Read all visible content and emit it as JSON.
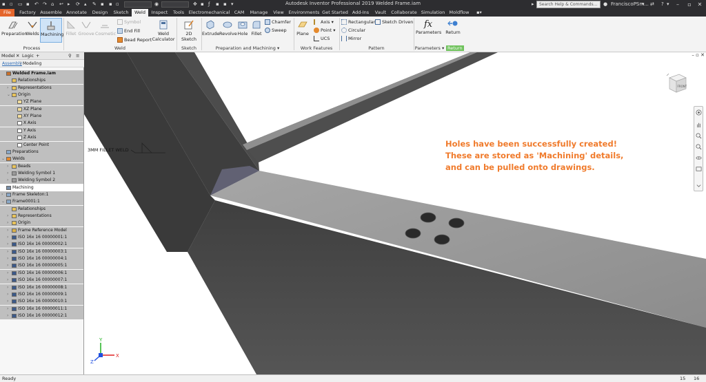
{
  "app": {
    "title": "Autodesk Inventor Professional 2019   Welded Frame.iam",
    "search_placeholder": "Search Help & Commands...",
    "user": "FranciscoPSm...",
    "help": "?"
  },
  "tabs": [
    "File",
    "Factory",
    "Assemble",
    "Annotate",
    "Design",
    "Sketch",
    "Weld",
    "Inspect",
    "Tools",
    "Electromechanical",
    "CAM",
    "Manage",
    "View",
    "Environments",
    "Get Started",
    "Add-Ins",
    "Vault",
    "Collaborate",
    "Simulation",
    "Moldflow"
  ],
  "ribbon": {
    "process": {
      "label": "Process",
      "preparation": "Preparation",
      "welds": "Welds",
      "machining": "Machining"
    },
    "weld": {
      "label": "Weld",
      "fillet": "Fillet",
      "groove": "Groove",
      "cosmetic": "Cosmetic",
      "symbol": "Symbol",
      "end_fill": "End Fill",
      "bead_report": "Bead Report",
      "weld_calculator": "Weld Calculator"
    },
    "sketch": {
      "label": "Sketch",
      "sketch_2d": "2D Sketch"
    },
    "prep": {
      "label": "Preparation and Machining",
      "extrude": "Extrude",
      "revolve": "Revolve",
      "hole": "Hole",
      "fillet": "Fillet",
      "chamfer": "Chamfer",
      "sweep": "Sweep"
    },
    "work": {
      "label": "Work Features",
      "plane": "Plane",
      "axis": "Axis",
      "point": "Point",
      "ucs": "UCS"
    },
    "pattern": {
      "label": "Pattern",
      "rectangular": "Rectangular",
      "circular": "Circular",
      "mirror": "Mirror",
      "sketch_driven": "Sketch Driven"
    },
    "params": {
      "label": "Parameters",
      "parameters": "Parameters",
      "return": "Return",
      "return_label": "Return"
    }
  },
  "browser": {
    "tab_model": "Model",
    "tab_logic": "Logic",
    "sub_assembly": "Assembly",
    "sub_modeling": "Modeling",
    "nodes": [
      {
        "label": "Welded Frame.iam",
        "level": 0,
        "icon": "assembly",
        "root": true
      },
      {
        "label": "Relationships",
        "level": 1,
        "icon": "folder"
      },
      {
        "label": "Representations",
        "level": 1,
        "icon": "folder",
        "chev": ">"
      },
      {
        "label": "Origin",
        "level": 1,
        "icon": "folder",
        "chev": "v"
      },
      {
        "label": "YZ Plane",
        "level": 2,
        "icon": "plane"
      },
      {
        "label": "XZ Plane",
        "level": 2,
        "icon": "plane"
      },
      {
        "label": "XY Plane",
        "level": 2,
        "icon": "plane"
      },
      {
        "label": "X Axis",
        "level": 2,
        "icon": "axis"
      },
      {
        "label": "Y Axis",
        "level": 2,
        "icon": "axis"
      },
      {
        "label": "Z Axis",
        "level": 2,
        "icon": "axis"
      },
      {
        "label": "Center Point",
        "level": 2,
        "icon": "point"
      },
      {
        "label": "Preparations",
        "level": 0,
        "icon": "prep"
      },
      {
        "label": "Welds",
        "level": 0,
        "icon": "weld",
        "chev": "v"
      },
      {
        "label": "Beads",
        "level": 1,
        "icon": "folder",
        "chev": ">"
      },
      {
        "label": "Welding Symbol 1",
        "level": 1,
        "icon": "symbol",
        "chev": ">"
      },
      {
        "label": "Welding Symbol 2",
        "level": 1,
        "icon": "symbol",
        "chev": ">"
      },
      {
        "label": "Machining",
        "level": 0,
        "icon": "machining",
        "highlight": true
      },
      {
        "label": "Frame Skeleton:1",
        "level": 0,
        "icon": "part",
        "chev": ">"
      },
      {
        "label": "Frame0001:1",
        "level": 0,
        "icon": "part",
        "chev": "v"
      },
      {
        "label": "Relationships",
        "level": 1,
        "icon": "folder"
      },
      {
        "label": "Representations",
        "level": 1,
        "icon": "folder",
        "chev": ">"
      },
      {
        "label": "Origin",
        "level": 1,
        "icon": "folder",
        "chev": ">"
      },
      {
        "label": "Frame Reference Model",
        "level": 1,
        "icon": "frame",
        "chev": ">"
      },
      {
        "label": "ISO 16x 16 00000001:1",
        "level": 1,
        "icon": "beam",
        "chev": ">"
      },
      {
        "label": "ISO 16x 16 00000002:1",
        "level": 1,
        "icon": "beam",
        "chev": ">"
      },
      {
        "label": "ISO 16x 16 00000003:1",
        "level": 1,
        "icon": "beam",
        "chev": ">"
      },
      {
        "label": "ISO 16x 16 00000004:1",
        "level": 1,
        "icon": "beam",
        "chev": ">"
      },
      {
        "label": "ISO 16x 16 00000005:1",
        "level": 1,
        "icon": "beam",
        "chev": ">"
      },
      {
        "label": "ISO 16x 16 00000006:1",
        "level": 1,
        "icon": "beam",
        "chev": ">"
      },
      {
        "label": "ISO 16x 16 00000007:1",
        "level": 1,
        "icon": "beam",
        "chev": ">"
      },
      {
        "label": "ISO 16x 16 00000008:1",
        "level": 1,
        "icon": "beam",
        "chev": ">"
      },
      {
        "label": "ISO 16x 16 00000009:1",
        "level": 1,
        "icon": "beam",
        "chev": ">"
      },
      {
        "label": "ISO 16x 16 00000010:1",
        "level": 1,
        "icon": "beam",
        "chev": ">"
      },
      {
        "label": "ISO 16x 16 00000011:1",
        "level": 1,
        "icon": "beam",
        "chev": ">"
      },
      {
        "label": "ISO 16x 16 00000012:1",
        "level": 1,
        "icon": "beam",
        "chev": ">"
      }
    ]
  },
  "viewport": {
    "annotation": [
      "Holes have been successfully created!",
      "These are stored as 'Machining' details,",
      "and can be pulled onto drawings."
    ],
    "weld_label": "3MM FILLET WELD",
    "viewcube_face": "FRONT",
    "axis_x": "X",
    "axis_y": "Y",
    "axis_z": "Z"
  },
  "status": {
    "text": "Ready",
    "num1": "15",
    "num2": "16"
  },
  "colors": {
    "file_tab": "#e4652b",
    "annotation": "#f07b2c",
    "return_green": "#6fc25c",
    "beam_side": "#4a4a4a",
    "beam_top": "#a0a0a0"
  }
}
